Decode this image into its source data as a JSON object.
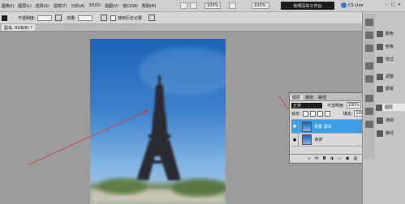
{
  "menubar": {
    "items": [
      "图像(I)",
      "图层(L)",
      "选择(S)",
      "滤镜(T)",
      "分析(A)",
      "3D(D)",
      "视图(V)",
      "窗口(W)",
      "帮助(H)"
    ],
    "zoom1": "100%",
    "zoom2": "100%",
    "workspace": "有明写的工作台",
    "cs_live": "CS Live"
  },
  "options_bar": {
    "opacity_label": "不透明度:",
    "opacity_value": "100%",
    "flow_label": "流量:",
    "flow_value": "100%",
    "history_label": "抹到历史记录"
  },
  "document_tab": "副本, RGB/8) *",
  "layers_panel": {
    "tabs": [
      "图层",
      "通道",
      "路径"
    ],
    "blend_mode": "正常",
    "opacity_label": "不透明度:",
    "opacity_value": "100%",
    "lock_label": "锁定:",
    "fill_label": "填充:",
    "fill_value": "100%",
    "layers": [
      {
        "name": "背景 副本",
        "selected": true
      },
      {
        "name": "背景",
        "selected": false
      }
    ],
    "footer_icons": [
      "link-icon",
      "fx-icon",
      "mask-icon",
      "adjust-icon",
      "folder-icon",
      "new-layer-icon",
      "trash-icon"
    ]
  },
  "dock": {
    "entries": [
      "颜色",
      "色板",
      "样式",
      "调整",
      "蒙版",
      "图层",
      "通道",
      "路径"
    ],
    "active": "图层"
  },
  "colors": {
    "accent": "#3d9ee8",
    "arrow": "#d23a3a"
  }
}
